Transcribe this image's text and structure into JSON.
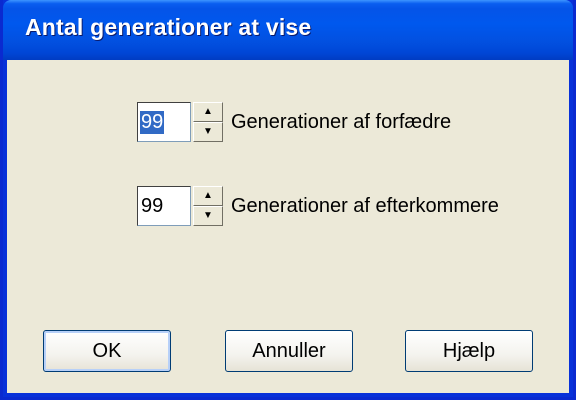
{
  "window": {
    "title": "Antal generationer at vise"
  },
  "fields": [
    {
      "value": "99",
      "label": "Generationer af forfædre",
      "selected": true
    },
    {
      "value": "99",
      "label": "Generationer af efterkommere",
      "selected": false
    }
  ],
  "spin": {
    "up_glyph": "▲",
    "down_glyph": "▼"
  },
  "buttons": {
    "ok": "OK",
    "cancel": "Annuller",
    "help": "Hjælp"
  },
  "colors": {
    "titlebar": "#0058ee",
    "selection": "#316ac5",
    "dialog_bg": "#ece9d8"
  }
}
